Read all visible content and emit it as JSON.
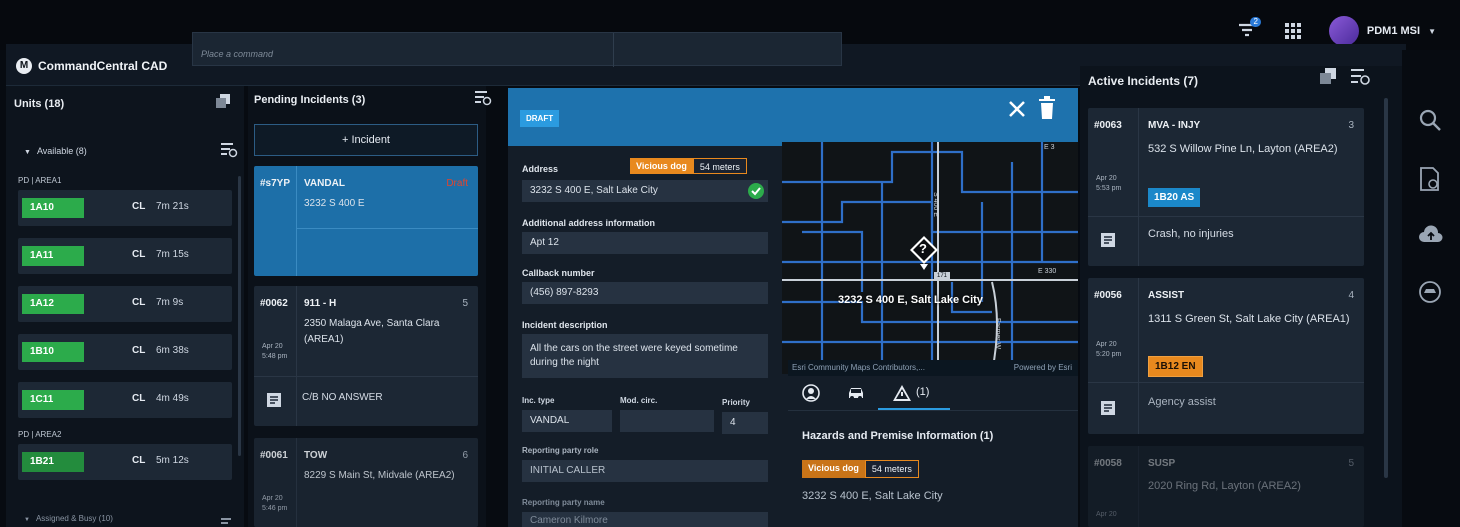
{
  "topbar": {
    "notif_count": "2",
    "user_name": "PDM1 MSI",
    "user_caret": "▼"
  },
  "app": {
    "title": "CommandCentral CAD",
    "logo_letter": "M",
    "command_placeholder": "Place a command"
  },
  "units": {
    "header": "Units (18)",
    "available_label": "Available (8)",
    "collapse_glyph": "▼",
    "group1": "PD | AREA1",
    "group2": "PD | AREA2",
    "items": [
      {
        "id": "1A10",
        "status": "CL",
        "time": "7m 21s"
      },
      {
        "id": "1A11",
        "status": "CL",
        "time": "7m 15s"
      },
      {
        "id": "1A12",
        "status": "CL",
        "time": "7m 9s"
      },
      {
        "id": "1B10",
        "status": "CL",
        "time": "6m 38s"
      },
      {
        "id": "1C11",
        "status": "CL",
        "time": "4m 49s"
      },
      {
        "id": "1B21",
        "status": "CL",
        "time": "5m 12s"
      }
    ],
    "assigned_label": "Assigned & Busy (10)"
  },
  "pending": {
    "header": "Pending Incidents (3)",
    "add_label": "+ Incident",
    "cards": [
      {
        "id": "#s7YP",
        "type": "VANDAL",
        "addr": "3232 S 400 E",
        "flag": "Draft"
      },
      {
        "id": "#0062",
        "type": "911 - H",
        "num": "5",
        "addr": "2350 Malaga Ave, Santa Clara (AREA1)",
        "date": "Apr 20",
        "time": "5:48 pm",
        "note": "C/B NO ANSWER"
      },
      {
        "id": "#0061",
        "type": "TOW",
        "num": "6",
        "addr": "8229 S Main St, Midvale (AREA2)",
        "date": "Apr 20",
        "time": "5:46 pm"
      }
    ]
  },
  "draft": {
    "tag": "DRAFT",
    "address_label": "Address",
    "hazard_name": "Vicious dog",
    "hazard_dist": "54 meters",
    "address_value": "3232 S 400 E, Salt Lake City",
    "addl_label": "Additional address information",
    "addl_value": "Apt 12",
    "callback_label": "Callback number",
    "callback_value": "(456) 897-8293",
    "desc_label": "Incident description",
    "desc_value": "All the cars on the street were keyed sometime during the night",
    "inc_type_label": "Inc. type",
    "inc_type_value": "VANDAL",
    "mod_label": "Mod. circ.",
    "priority_label": "Priority",
    "priority_value": "4",
    "rp_role_label": "Reporting party role",
    "rp_role_value": "INITIAL CALLER",
    "rp_name_label": "Reporting party name",
    "rp_name_value": "Cameron Kilmore"
  },
  "map": {
    "pin_label": "3232 S 400 E, Salt Lake City",
    "pin_symbol": "?",
    "route_label": "171",
    "street_400e": "S 400 E",
    "street_e330": "E 330",
    "street_e3": "E 3",
    "street_farmer": "Farmer W",
    "attribution": "Esri Community Maps Contributors,...",
    "powered": "Powered by Esri",
    "hazard_tab_count": "(1)",
    "haz_info_title": "Hazards and Premise Information (1)",
    "haz_name": "Vicious dog",
    "haz_dist": "54 meters",
    "haz_addr": "3232 S 400 E, Salt Lake City"
  },
  "active": {
    "header": "Active Incidents (7)",
    "cards": [
      {
        "id": "#0063",
        "type": "MVA - INJY",
        "num": "3",
        "addr": "532 S Willow Pine Ln, Layton (AREA2)",
        "date": "Apr 20",
        "time": "5:53 pm",
        "unit": "1B20 AS",
        "unit_color": "#1b88c9",
        "note": "Crash, no injuries"
      },
      {
        "id": "#0056",
        "type": "ASSIST",
        "num": "4",
        "addr": "1311 S Green St, Salt Lake City (AREA1)",
        "date": "Apr 20",
        "time": "5:20 pm",
        "unit": "1B12 EN",
        "unit_color": "#e8891e",
        "note": "Agency assist"
      },
      {
        "id": "#0058",
        "type": "SUSP",
        "num": "5",
        "addr": "2020 Ring Rd, Layton (AREA2)",
        "date": "Apr 20"
      }
    ]
  }
}
